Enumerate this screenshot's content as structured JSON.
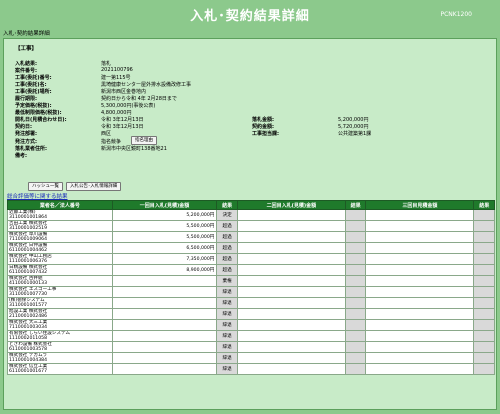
{
  "header": {
    "title": "入札･契約結果詳細",
    "code": "PCNK1200"
  },
  "breadcrumb": "入札･契約結果詳細",
  "section_label": "【工事】",
  "fields": [
    {
      "label": "入札結果:",
      "value": "落札"
    },
    {
      "label": "案件番号:",
      "value": "2021100796"
    },
    {
      "label": "工事(委託)番号:",
      "value": "建一第115号"
    },
    {
      "label": "工事(委託)名:",
      "value": "黒埼健康センター屋外排水設備改修工事"
    },
    {
      "label": "工事(委託)場所:",
      "value": "新潟市西区金巻地内"
    },
    {
      "label": "履行期限:",
      "value": "契約日から令和 4年 2月28日まで"
    },
    {
      "label": "予定価格(税抜):",
      "value": "5,300,000円(事後公表)"
    },
    {
      "label": "最低制限価格(税抜):",
      "value": "4,800,000円"
    },
    {
      "label": "開札日(見積合わせ日):",
      "value": "令和 3年12月13日"
    },
    {
      "label": "契約日:",
      "value": "令和 3年12月13日"
    },
    {
      "label": "発注部署:",
      "value": "西区"
    },
    {
      "label": "発注方式:",
      "value": "指名競争"
    },
    {
      "label": "落札業者住所:",
      "value": "新潟市中央区鏡町138番地21"
    },
    {
      "label": "備考:",
      "value": ""
    }
  ],
  "right_fields": [
    {
      "label": "落札金額:",
      "value": "5,200,000円"
    },
    {
      "label": "契約金額:",
      "value": "5,720,000円"
    },
    {
      "label": "工事担当課:",
      "value": "公共建築第1課"
    }
  ],
  "buttons": {
    "nomination_reason": "指名理由",
    "history": "ハッシュ一覧",
    "notice": "入札公告･入札情報詳細"
  },
  "eval_link": "総合評価等に関する結果",
  "table": {
    "headers": [
      "業者名／法人番号",
      "一回目入札(見積)金額",
      "結果",
      "二回目入札(見積)金額",
      "結果",
      "三回目見積金額",
      "結果"
    ],
    "rows": [
      {
        "name": "近藤工業(株)",
        "corp": "3110001001864",
        "amount": "5,200,000円",
        "result": "決定"
      },
      {
        "name": "吉田工業 株式会社",
        "corp": "3110001002519",
        "amount": "5,500,000円",
        "result": "超過"
      },
      {
        "name": "株式会社 草川設備",
        "corp": "7110001009064",
        "amount": "5,500,000円",
        "result": "超過"
      },
      {
        "name": "株式会社 日伸設備",
        "corp": "6110001004462",
        "amount": "6,500,000円",
        "result": "超過"
      },
      {
        "name": "株式会社 中山工務店",
        "corp": "1110001006376",
        "amount": "7,350,000円",
        "result": "超過"
      },
      {
        "name": "日精設備 株式会社",
        "corp": "6110001007432",
        "amount": "8,900,000円",
        "result": "超過"
      },
      {
        "name": "株式会社 古井組",
        "corp": "4110001000133",
        "amount": "",
        "result": "棄権"
      },
      {
        "name": "株式会社 エスゴー工事",
        "corp": "3110001007730",
        "amount": "",
        "result": "辞退"
      },
      {
        "name": "(株)徳保システム",
        "corp": "3110001001577",
        "amount": "",
        "result": "辞退"
      },
      {
        "name": "旭設工業 株式会社",
        "corp": "2110001002486",
        "amount": "",
        "result": "辞退"
      },
      {
        "name": "株式会社 大三工業",
        "corp": "7110001003034",
        "amount": "",
        "result": "辞退"
      },
      {
        "name": "有限会社 しらい住設システム",
        "corp": "1110002011058",
        "amount": "",
        "result": "辞退"
      },
      {
        "name": "ときわ設備 株式会社",
        "corp": "6110001003578",
        "amount": "",
        "result": "辞退"
      },
      {
        "name": "株式会社 テカムラ",
        "corp": "1110001004384",
        "amount": "",
        "result": "辞退"
      },
      {
        "name": "株式会社 信立工業",
        "corp": "6110001001677",
        "amount": "",
        "result": "辞退"
      }
    ]
  }
}
